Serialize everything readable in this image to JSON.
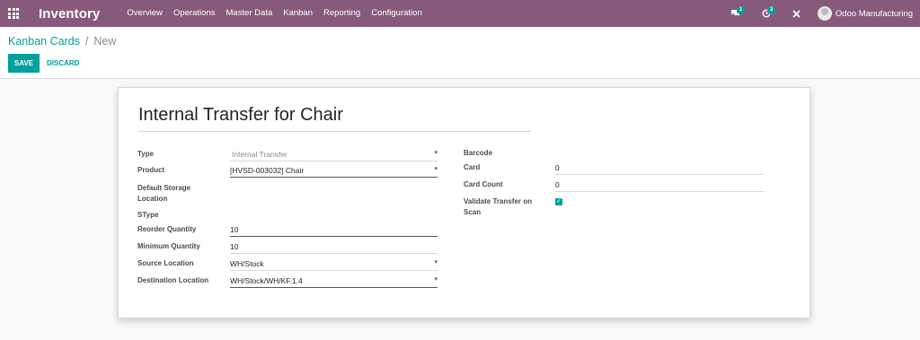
{
  "navbar": {
    "app_name": "Inventory",
    "menu": [
      "Overview",
      "Operations",
      "Master Data",
      "Kanban",
      "Reporting",
      "Configuration"
    ],
    "messages_badge": "1",
    "activities_badge": "3",
    "user_name": "Odoo Manufacturing",
    "icons": [
      "apps-grid-icon",
      "chat-icon",
      "clock-icon",
      "close-icon"
    ],
    "accent_color": "#875a7b"
  },
  "control": {
    "breadcrumb_parent": "Kanban Cards",
    "breadcrumb_separator": "/",
    "breadcrumb_current": "New",
    "save_label": "SAVE",
    "discard_label": "DISCARD",
    "primary_color": "#00a09d"
  },
  "form": {
    "title": "Internal Transfer for Chair",
    "left": {
      "type_label": "Type",
      "type_value": "Internal Transfer",
      "product_label": "Product",
      "product_value": "[HVSD-003032] Chair",
      "default_storage_label_1": "Default Storage",
      "default_storage_label_2": "Location",
      "stype_label": "SType",
      "reorder_label": "Reorder Quantity",
      "reorder_value": "10",
      "minimum_label": "Minimum Quantity",
      "minimum_value": "10",
      "source_label": "Source Location",
      "source_value": "WH/Stock",
      "destination_label": "Destination Location",
      "destination_value": "WH/Stock/WH/KF.1.4"
    },
    "right": {
      "barcode_label": "Barcode",
      "card_label": "Card",
      "card_value": "0",
      "card_count_label": "Card Count",
      "card_count_value": "0",
      "validate_label_1": "Validate Transfer on",
      "validate_label_2": "Scan",
      "validate_checked": true
    }
  }
}
